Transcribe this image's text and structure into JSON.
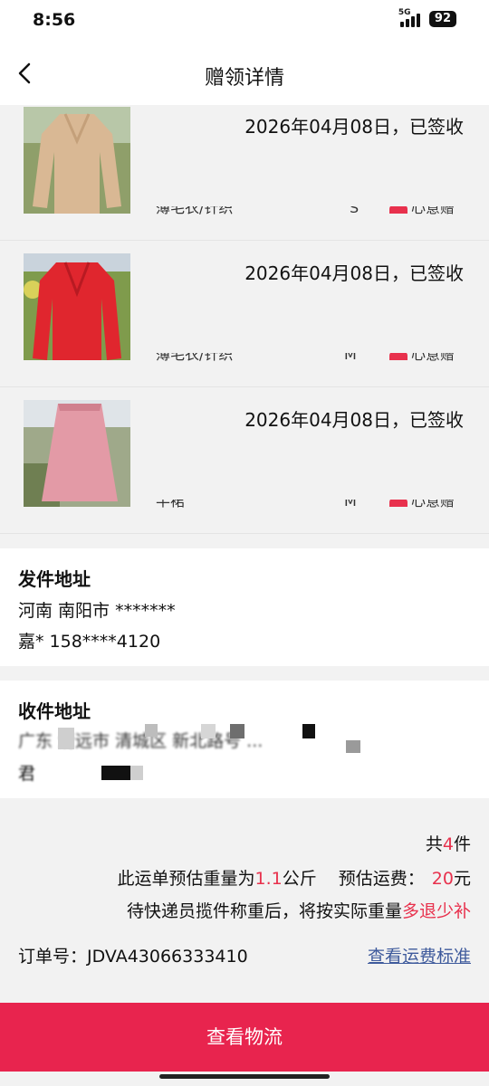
{
  "status_bar": {
    "time": "8:56",
    "network": "5G",
    "battery": "92"
  },
  "header": {
    "title": "赠领详情",
    "back_icon": "chevron-left-icon"
  },
  "items": [
    {
      "date_status": "2026年04月08日，已签收",
      "category": "薄毛衣/针织",
      "size": "S",
      "tag": "心意赠",
      "image": "beige-sweater"
    },
    {
      "date_status": "2026年04月08日，已签收",
      "category": "薄毛衣/针织",
      "size": "M",
      "tag": "心意赠",
      "image": "red-sweater"
    },
    {
      "date_status": "2026年04月08日，已签收",
      "category": "半裙",
      "size": "M",
      "tag": "心意赠",
      "image": "pink-skirt"
    }
  ],
  "sender": {
    "title": "发件地址",
    "address": "河南 南阳市 *******",
    "contact": "嘉* 158****4120"
  },
  "receiver": {
    "title": "收件地址",
    "address": "广东 清远市 清城区 新北路号 ...",
    "contact": "君"
  },
  "summary": {
    "count_prefix": "共",
    "count": "4",
    "count_suffix": "件",
    "weight_prefix": "此运单预估重量为",
    "weight_value": "1.1",
    "weight_unit": "公斤",
    "fee_label": "预估运费：",
    "fee_value": "20",
    "fee_unit": "元",
    "notice_prefix": "待快递员揽件称重后，将按实际重量",
    "notice_highlight": "多退少补",
    "order_label": "订单号：",
    "order_number": "JDVA43066333410",
    "fee_standard_link": "查看运费标准"
  },
  "bottom_button": "查看物流",
  "colors": {
    "accent": "#e8244e",
    "link": "#3e5a9c",
    "background": "#f2f2f2"
  }
}
